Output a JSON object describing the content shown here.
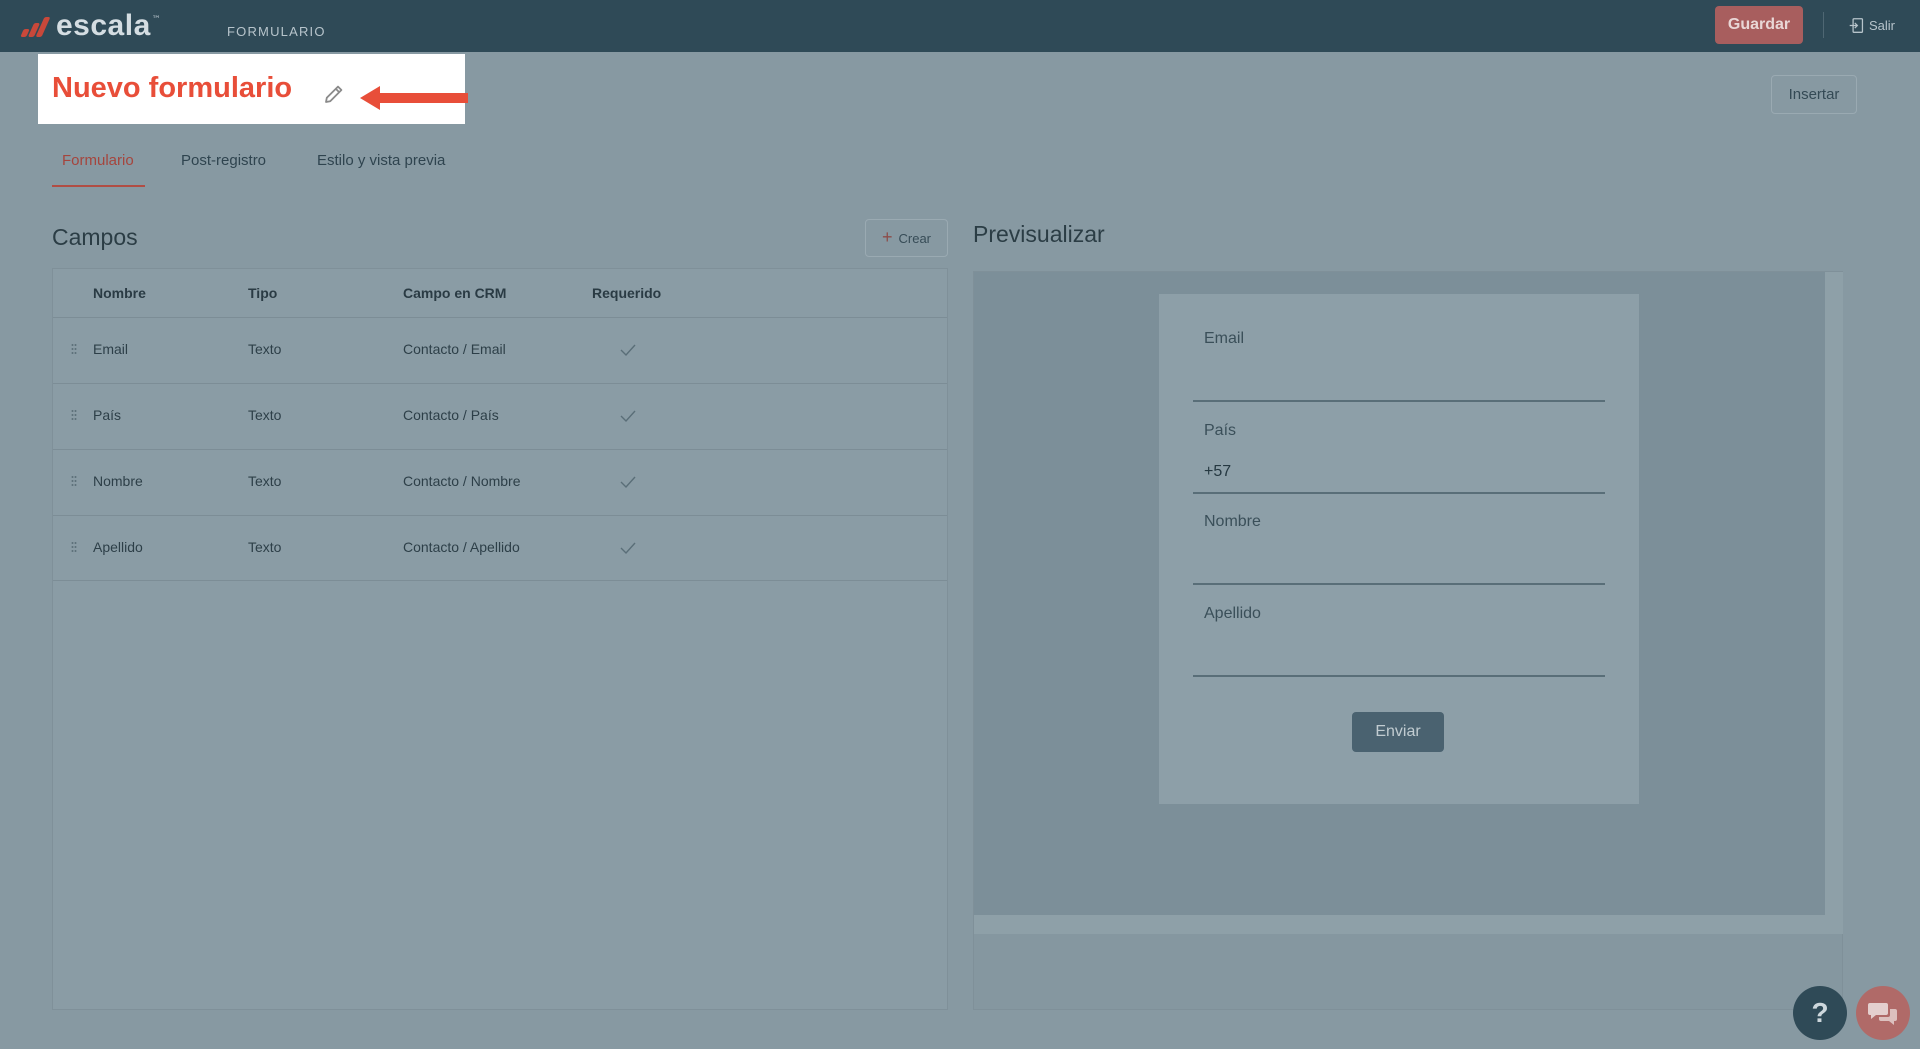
{
  "app": {
    "logo_text": "escala",
    "logo_tm": "™",
    "section_label": "FORMULARIO"
  },
  "header": {
    "save_label": "Guardar",
    "logout_label": "Salir"
  },
  "page": {
    "title": "Nuevo formulario",
    "insert_label": "Insertar"
  },
  "tabs": [
    {
      "label": "Formulario",
      "active": true
    },
    {
      "label": "Post-registro",
      "active": false
    },
    {
      "label": "Estilo y vista previa",
      "active": false
    }
  ],
  "fields_panel": {
    "title": "Campos",
    "create_label": "Crear",
    "columns": [
      "Nombre",
      "Tipo",
      "Campo en CRM",
      "Requerido"
    ],
    "rows": [
      {
        "name": "Email",
        "type": "Texto",
        "crm": "Contacto / Email",
        "required": true
      },
      {
        "name": "País",
        "type": "Texto",
        "crm": "Contacto / País",
        "required": true
      },
      {
        "name": "Nombre",
        "type": "Texto",
        "crm": "Contacto / Nombre",
        "required": true
      },
      {
        "name": "Apellido",
        "type": "Texto",
        "crm": "Contacto / Apellido",
        "required": true
      }
    ]
  },
  "preview": {
    "title": "Previsualizar",
    "fields": [
      {
        "label": "Email",
        "value": ""
      },
      {
        "label": "País",
        "value": "+57"
      },
      {
        "label": "Nombre",
        "value": ""
      },
      {
        "label": "Apellido",
        "value": ""
      }
    ],
    "submit_label": "Enviar"
  },
  "help": {
    "help_label": "?",
    "help_icon": "question-icon",
    "chat_icon": "chat-icon"
  },
  "colors": {
    "accent": "#e84e39",
    "topbar": "#2f4a57",
    "overlay": "#8799a2"
  }
}
